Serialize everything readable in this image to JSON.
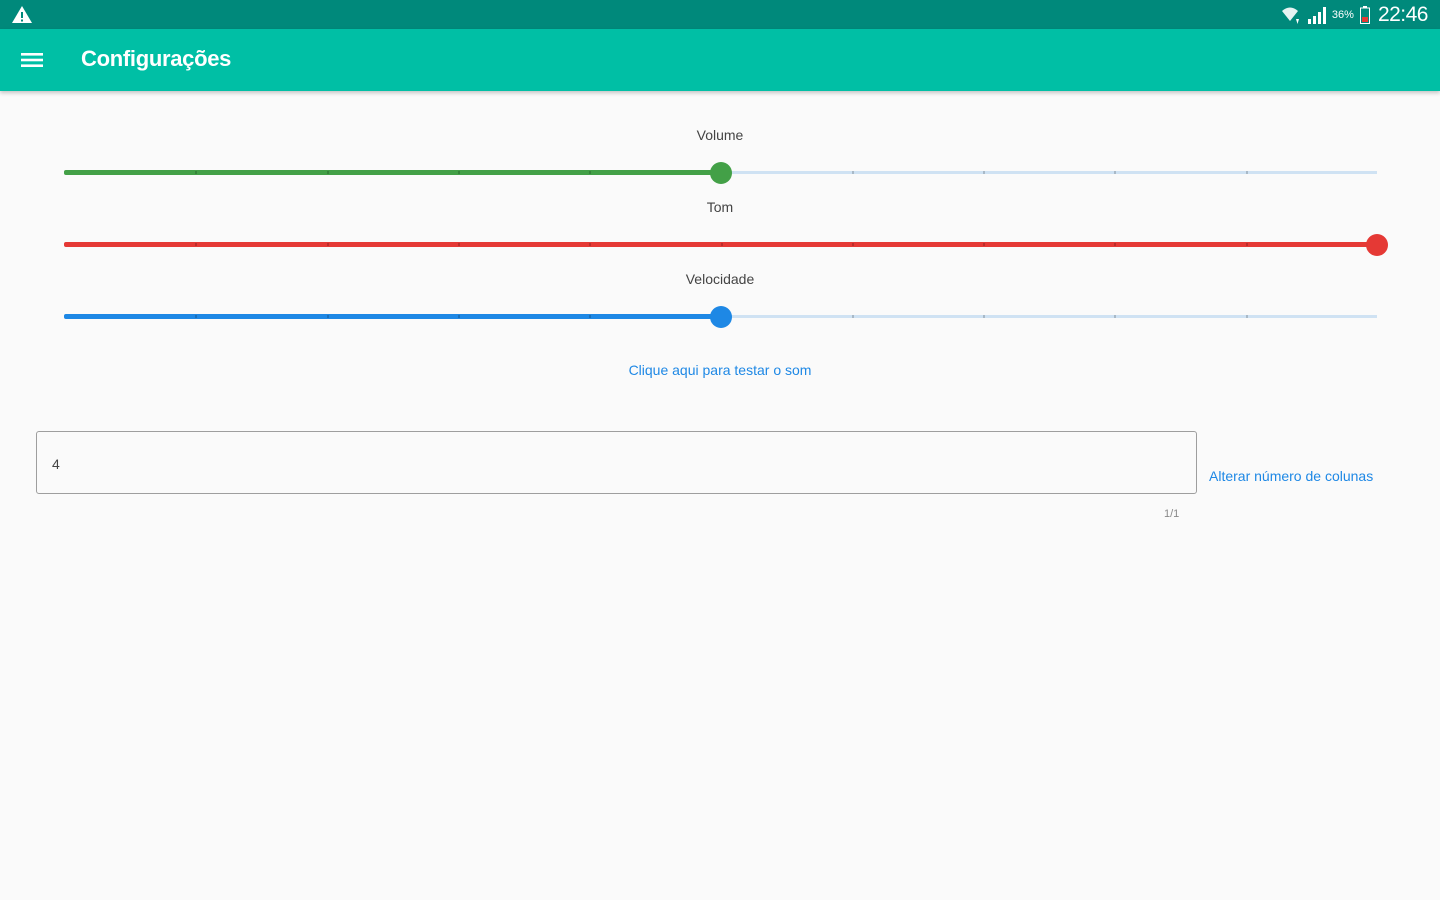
{
  "status_bar": {
    "alert_icon": "warning-icon",
    "wifi_icon": "wifi-icon",
    "signal_icon": "signal-icon",
    "battery_percent": "36%",
    "battery_icon": "battery-low-icon",
    "time": "22:46"
  },
  "app_bar": {
    "menu_icon": "hamburger-menu-icon",
    "title": "Configurações"
  },
  "sliders": [
    {
      "label": "Volume",
      "value": 0.5,
      "color": "#43a047"
    },
    {
      "label": "Tom",
      "value": 1.0,
      "color": "#e53935"
    },
    {
      "label": "Velocidade",
      "value": 0.5,
      "color": "#1e88e5"
    }
  ],
  "test_sound_link": "Clique aqui para testar o som",
  "columns_field": {
    "value": "4",
    "counter": "1/1"
  },
  "alter_columns_link": "Alterar número de colunas",
  "colors": {
    "status_bar": "#00897b",
    "app_bar": "#00bfa5",
    "link": "#1e88e5"
  }
}
